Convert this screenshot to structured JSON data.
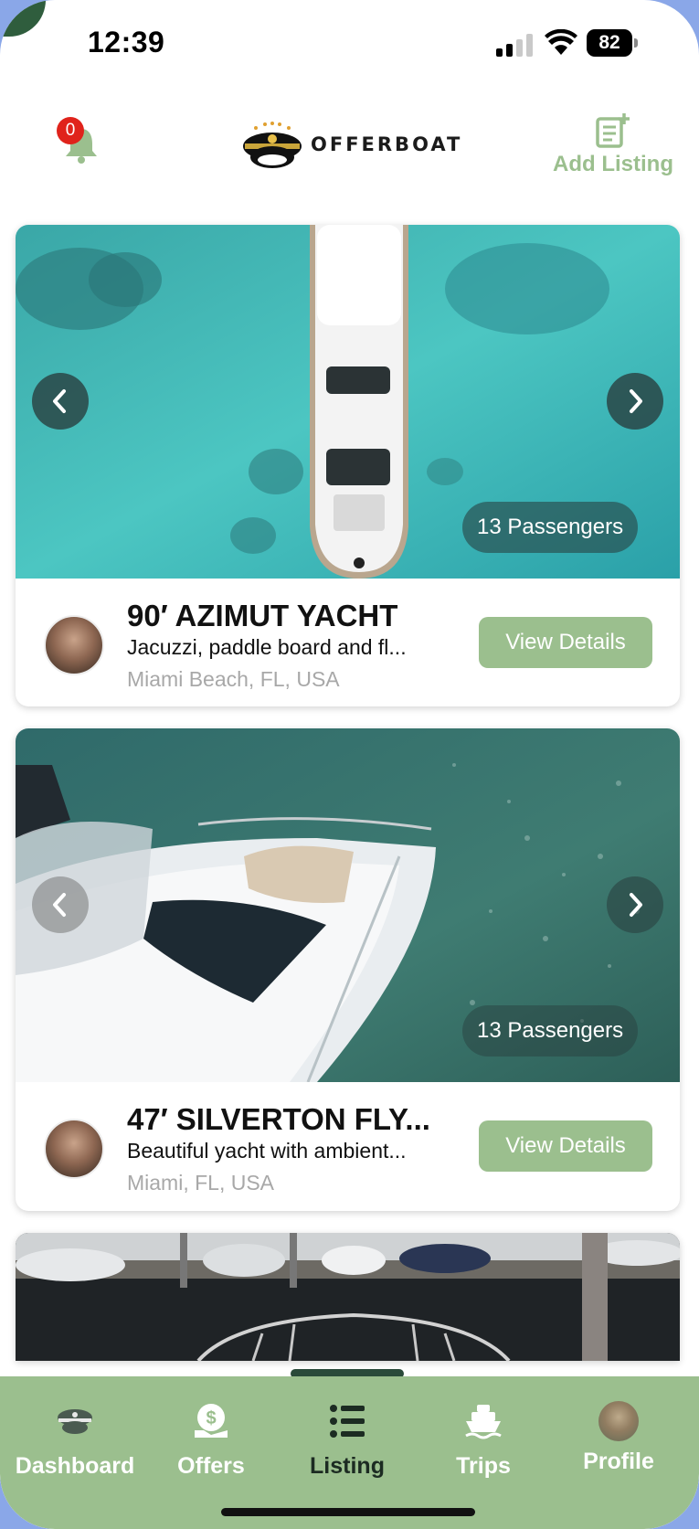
{
  "status_bar": {
    "time": "12:39",
    "battery": "82"
  },
  "header": {
    "notification_count": "0",
    "logo_text": "OFFERBOAT",
    "add_listing_label": "Add Listing"
  },
  "listings": [
    {
      "title": "90′ AZIMUT YACHT",
      "description": "Jacuzzi, paddle board and fl...",
      "location": "Miami Beach, FL, USA",
      "passengers": "13 Passengers",
      "button": "View Details"
    },
    {
      "title": "47′ SILVERTON FLY...",
      "description": "Beautiful yacht with ambient...",
      "location": "Miami, FL, USA",
      "passengers": "13 Passengers",
      "button": "View Details"
    }
  ],
  "tabs": [
    {
      "label": "Dashboard",
      "icon": "captain-hat-icon"
    },
    {
      "label": "Offers",
      "icon": "money-bag-icon"
    },
    {
      "label": "Listing",
      "icon": "list-icon",
      "active": true
    },
    {
      "label": "Trips",
      "icon": "boat-icon"
    },
    {
      "label": "Profile",
      "icon": "avatar-icon"
    }
  ],
  "colors": {
    "accent": "#9bbf8e",
    "badge": "#e0231b",
    "active_tab_text": "#1c2b22"
  }
}
